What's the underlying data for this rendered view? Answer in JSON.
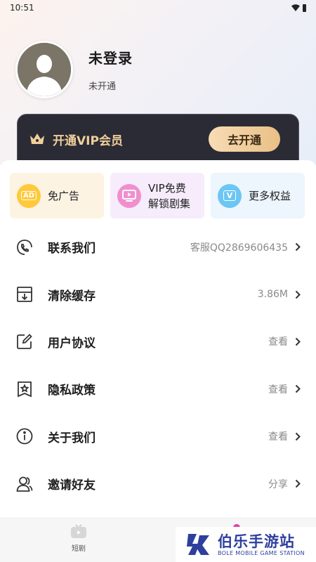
{
  "status_bar": {
    "time": "10:51"
  },
  "profile": {
    "name": "未登录",
    "status": "未开通"
  },
  "vip": {
    "title": "开通VIP会员",
    "button": "去开通"
  },
  "features": [
    {
      "label": "免广告",
      "icon": "ad-icon"
    },
    {
      "label": "VIP免费解锁剧集",
      "line1": "VIP免费",
      "line2": "解锁剧集",
      "icon": "tv-icon"
    },
    {
      "label": "更多权益",
      "icon": "v-badge-icon"
    }
  ],
  "feature_badges": {
    "ad": "AD",
    "v": "V"
  },
  "menu": [
    {
      "label": "联系我们",
      "value": "客服QQ2869606435",
      "icon": "contact-phone-icon"
    },
    {
      "label": "清除缓存",
      "value": "3.86M",
      "icon": "clear-cache-icon"
    },
    {
      "label": "用户协议",
      "value": "查看",
      "icon": "edit-doc-icon"
    },
    {
      "label": "隐私政策",
      "value": "查看",
      "icon": "bookmark-star-icon"
    },
    {
      "label": "关于我们",
      "value": "查看",
      "icon": "info-icon"
    },
    {
      "label": "邀请好友",
      "value": "分享",
      "icon": "users-icon"
    }
  ],
  "bottom_nav": {
    "tab1": "短剧"
  },
  "watermark": {
    "title": "伯乐手游站",
    "subtitle": "BOLE MOBILE GAME STATION"
  },
  "colors": {
    "vip_gold": "#f0cf99",
    "vip_card": "#2b2b36",
    "accent_pink": "#e33fa8",
    "watermark_blue": "#2f3f9e"
  }
}
